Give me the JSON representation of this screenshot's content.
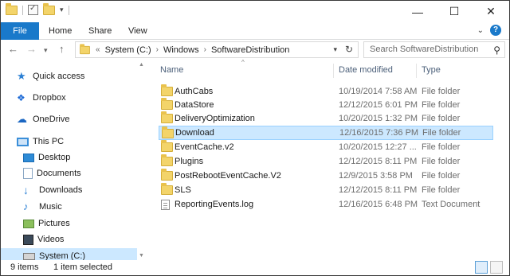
{
  "window": {
    "minimize": "—",
    "maximize": "☐",
    "close": "✕"
  },
  "ribbon": {
    "tabs": [
      {
        "label": "File"
      },
      {
        "label": "Home"
      },
      {
        "label": "Share"
      },
      {
        "label": "View"
      }
    ]
  },
  "address": {
    "overflow": "«",
    "crumbs": [
      "System (C:)",
      "Windows",
      "SoftwareDistribution"
    ],
    "search_placeholder": "Search SoftwareDistribution"
  },
  "nav_pane": {
    "items": [
      {
        "label": "Quick access",
        "icon": "star-icon"
      },
      {
        "label": "Dropbox",
        "icon": "dropbox-icon"
      },
      {
        "label": "OneDrive",
        "icon": "cloud-icon"
      },
      {
        "label": "This PC",
        "icon": "computer-icon"
      },
      {
        "label": "Desktop",
        "icon": "desktop-icon"
      },
      {
        "label": "Documents",
        "icon": "documents-icon"
      },
      {
        "label": "Downloads",
        "icon": "download-icon"
      },
      {
        "label": "Music",
        "icon": "music-icon"
      },
      {
        "label": "Pictures",
        "icon": "pictures-icon"
      },
      {
        "label": "Videos",
        "icon": "videos-icon"
      },
      {
        "label": "System (C:)",
        "icon": "drive-icon",
        "selected": true
      }
    ]
  },
  "file_list": {
    "columns": {
      "name": "Name",
      "date": "Date modified",
      "type": "Type"
    },
    "rows": [
      {
        "name": "AuthCabs",
        "date": "10/19/2014 7:58 AM",
        "type": "File folder",
        "icon": "folder-icon"
      },
      {
        "name": "DataStore",
        "date": "12/12/2015 6:01 PM",
        "type": "File folder",
        "icon": "folder-icon"
      },
      {
        "name": "DeliveryOptimization",
        "date": "10/20/2015 1:32 PM",
        "type": "File folder",
        "icon": "folder-icon"
      },
      {
        "name": "Download",
        "date": "12/16/2015 7:36 PM",
        "type": "File folder",
        "icon": "folder-icon",
        "selected": true
      },
      {
        "name": "EventCache.v2",
        "date": "10/20/2015 12:27 ...",
        "type": "File folder",
        "icon": "folder-icon"
      },
      {
        "name": "Plugins",
        "date": "12/12/2015 8:11 PM",
        "type": "File folder",
        "icon": "folder-icon"
      },
      {
        "name": "PostRebootEventCache.V2",
        "date": "12/9/2015 3:58 PM",
        "type": "File folder",
        "icon": "folder-icon"
      },
      {
        "name": "SLS",
        "date": "12/12/2015 8:11 PM",
        "type": "File folder",
        "icon": "folder-icon"
      },
      {
        "name": "ReportingEvents.log",
        "date": "12/16/2015 6:48 PM",
        "type": "Text Document",
        "icon": "text-document-icon"
      }
    ]
  },
  "status": {
    "item_count": "9 items",
    "selection": "1 item selected"
  },
  "colors": {
    "accent": "#1979ca",
    "selection": "#cce8ff",
    "folder": "#f3d46a"
  }
}
